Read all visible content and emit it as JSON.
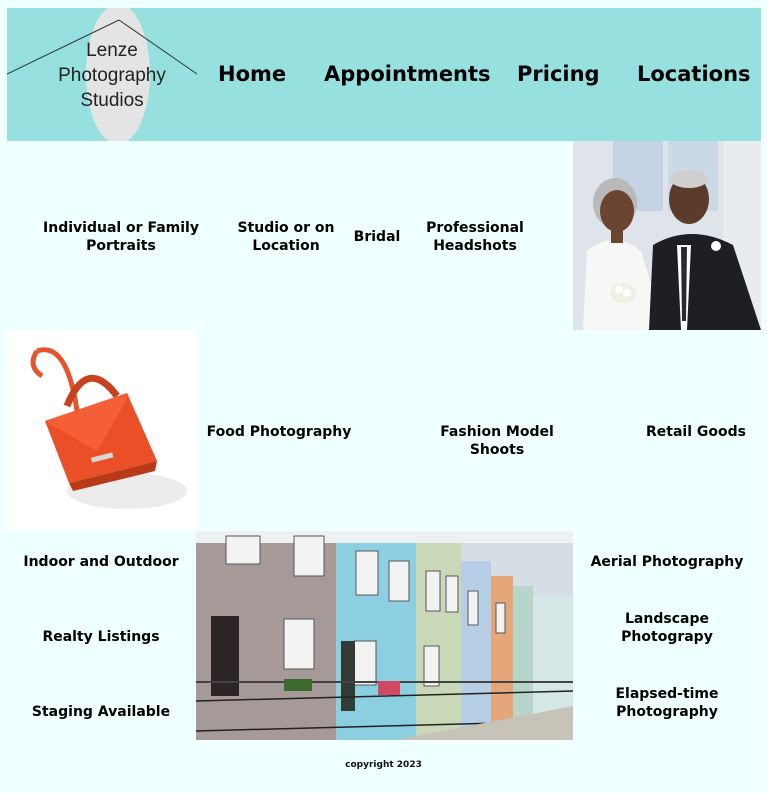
{
  "logo": {
    "line1": "Lenze",
    "line2": "Photography",
    "line3": "Studios"
  },
  "nav": {
    "home": "Home",
    "appointments": "Appointments",
    "pricing": "Pricing",
    "locations": "Locations"
  },
  "portraits": {
    "individual": "Individual or Family Portraits",
    "studio": "Studio or on Location",
    "bridal": "Bridal",
    "headshots": "Professional Headshots"
  },
  "products": {
    "food": "Food Photography",
    "fashion": "Fashion Model Shoots",
    "retail": "Retail Goods"
  },
  "property": {
    "indoor": "Indoor and Outdoor",
    "realty": "Realty Listings",
    "staging": "Staging Available",
    "aerial": "Aerial Photography",
    "landscape": "Landscape Photograpy",
    "elapsed": "Elapsed-time Photography"
  },
  "footer": "copyright 2023",
  "colors": {
    "header": "#97e0e0",
    "background": "#f0ffff"
  }
}
